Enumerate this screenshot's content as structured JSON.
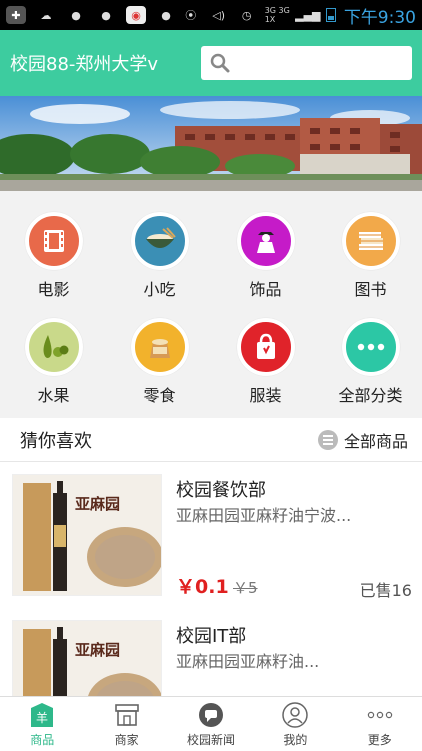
{
  "status_bar": {
    "network": "3G 3G\n1X",
    "time": "下午9:30"
  },
  "header": {
    "title": "校园88-郑州大学v",
    "search_placeholder": ""
  },
  "categories": [
    {
      "label": "电影",
      "icon": "film-icon",
      "color": "#e8694a"
    },
    {
      "label": "小吃",
      "icon": "bowl-icon",
      "color": "#3b8fb5"
    },
    {
      "label": "饰品",
      "icon": "figure-icon",
      "color": "#c51bc8"
    },
    {
      "label": "图书",
      "icon": "books-icon",
      "color": "#f2a94a"
    },
    {
      "label": "水果",
      "icon": "fruit-icon",
      "color": "#c9d98a"
    },
    {
      "label": "零食",
      "icon": "snack-bag-icon",
      "color": "#f2b22c"
    },
    {
      "label": "服装",
      "icon": "shopping-bag-icon",
      "color": "#e0232a"
    },
    {
      "label": "全部分类",
      "icon": "more-dots-icon",
      "color": "#2cc7a5"
    }
  ],
  "section": {
    "title": "猜你喜欢",
    "more_label": "全部商品"
  },
  "products": [
    {
      "shop": "校园餐饮部",
      "desc": "亚麻田园亚麻籽油宁波...",
      "price": "￥0.1",
      "old_price": "￥5",
      "sold": "已售16"
    },
    {
      "shop": "校园IT部",
      "desc": "亚麻田园亚麻籽油..."
    }
  ],
  "tabs": [
    {
      "label": "商品",
      "icon": "store-goods-icon",
      "active": true
    },
    {
      "label": "商家",
      "icon": "shop-icon",
      "active": false
    },
    {
      "label": "校园新闻",
      "icon": "chat-bubble-icon",
      "active": false
    },
    {
      "label": "我的",
      "icon": "user-icon",
      "active": false
    },
    {
      "label": "更多",
      "icon": "more-dots-icon",
      "active": false
    }
  ],
  "colors": {
    "header_bg": "#3dcc9f",
    "accent": "#2eb88a",
    "price": "#e02020"
  }
}
